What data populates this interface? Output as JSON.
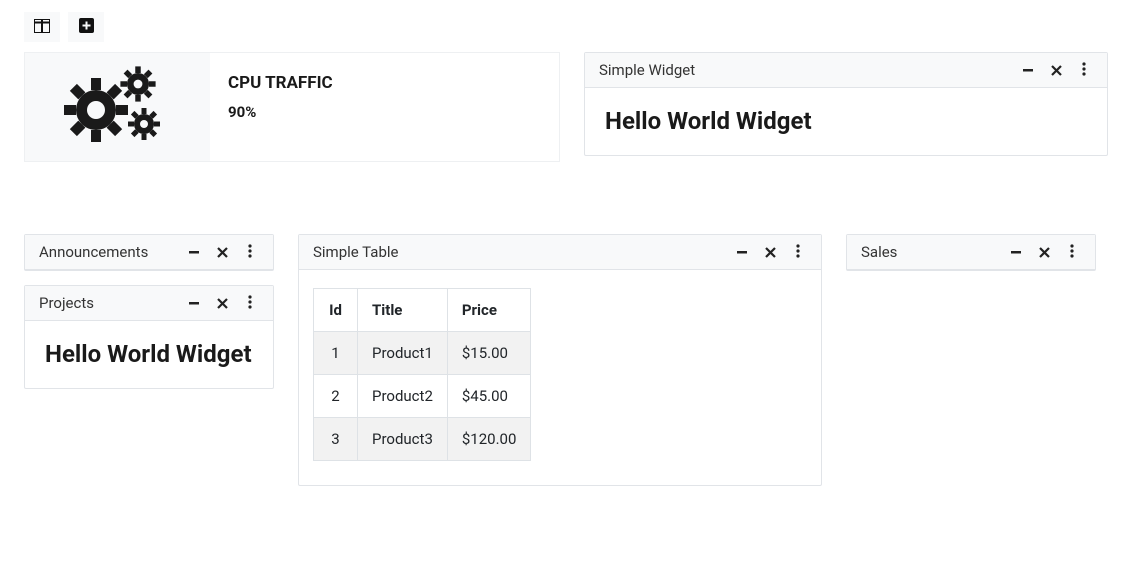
{
  "toolbar": {
    "layout_icon": "columns-icon",
    "add_icon": "plus-icon"
  },
  "info_box": {
    "icon": "gears-icon",
    "title": "CPU TRAFFIC",
    "value": "90%"
  },
  "simple_widget": {
    "title": "Simple Widget",
    "content": "Hello World Widget"
  },
  "announcements": {
    "title": "Announcements"
  },
  "projects": {
    "title": "Projects",
    "content": "Hello World Widget"
  },
  "simple_table": {
    "title": "Simple Table",
    "columns": [
      "Id",
      "Title",
      "Price"
    ],
    "rows": [
      {
        "id": "1",
        "title": "Product1",
        "price": "$15.00"
      },
      {
        "id": "2",
        "title": "Product2",
        "price": "$45.00"
      },
      {
        "id": "3",
        "title": "Product3",
        "price": "$120.00"
      }
    ]
  },
  "sales": {
    "title": "Sales"
  }
}
